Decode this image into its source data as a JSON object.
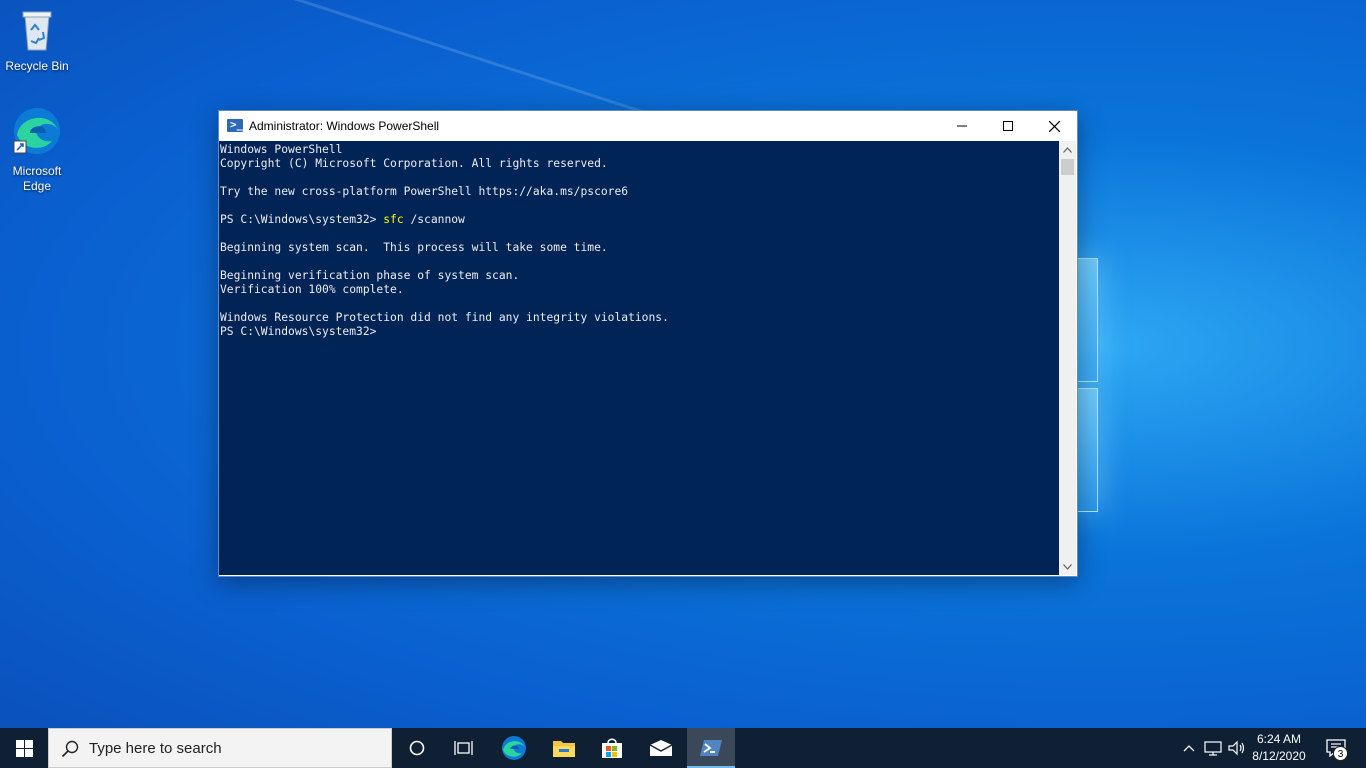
{
  "desktop": {
    "icons": [
      {
        "label": "Recycle Bin",
        "icon": "recycle-bin-icon"
      },
      {
        "label": "Microsoft Edge",
        "icon": "edge-icon"
      }
    ]
  },
  "window": {
    "title": "Administrator: Windows PowerShell",
    "icon": "powershell-icon",
    "controls": {
      "minimize": "minimize-icon",
      "maximize": "maximize-icon",
      "close": "close-icon"
    }
  },
  "console": {
    "lines": [
      "Windows PowerShell",
      "Copyright (C) Microsoft Corporation. All rights reserved.",
      "",
      "Try the new cross-platform PowerShell https://aka.ms/pscore6",
      "",
      "PS C:\\Windows\\system32> ",
      "",
      "Beginning system scan.  This process will take some time.",
      "",
      "Beginning verification phase of system scan.",
      "Verification 100% complete.",
      "",
      "Windows Resource Protection did not find any integrity violations.",
      "PS C:\\Windows\\system32>"
    ],
    "command": "sfc",
    "command_args": " /scannow",
    "background": "#012456",
    "foreground": "#eeedf0",
    "command_color": "#ffff00"
  },
  "taskbar": {
    "search_placeholder": "Type here to search",
    "apps": [
      "cortana-icon",
      "task-view-icon",
      "edge-icon",
      "file-explorer-icon",
      "store-icon",
      "mail-icon",
      "powershell-icon"
    ],
    "clock_time": "6:24 AM",
    "clock_date": "8/12/2020",
    "notification_count": "3"
  }
}
